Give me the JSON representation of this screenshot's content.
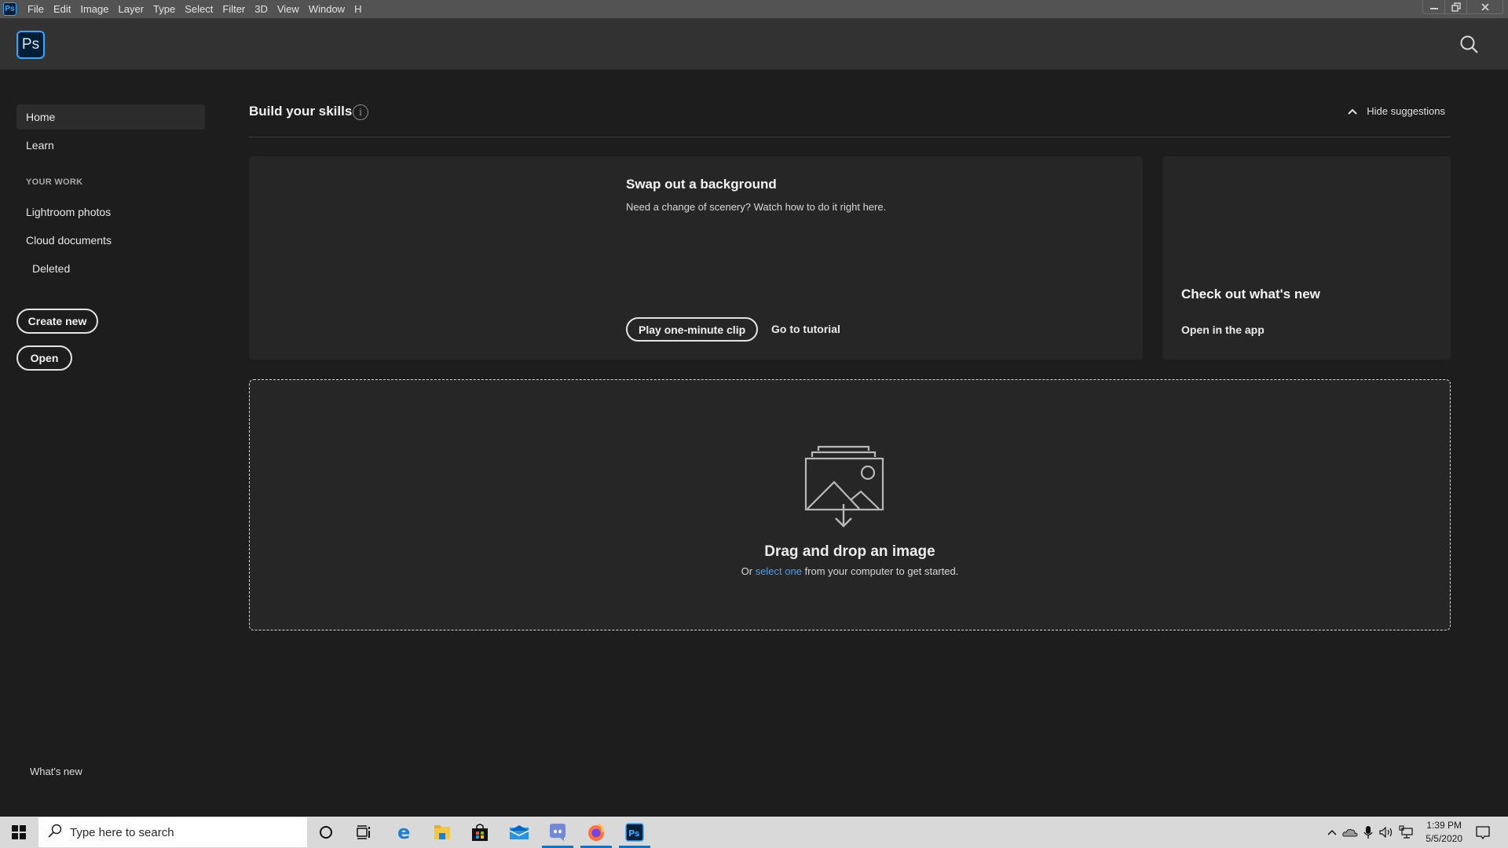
{
  "menubar": {
    "app_icon": "Ps",
    "items": [
      "File",
      "Edit",
      "Image",
      "Layer",
      "Type",
      "Select",
      "Filter",
      "3D",
      "View",
      "Window",
      "H"
    ],
    "window_controls": [
      "minimize-icon",
      "restore-icon",
      "close-icon"
    ]
  },
  "appbar": {
    "logo": "Ps",
    "search_icon": "search-icon"
  },
  "sidebar": {
    "items": [
      {
        "label": "Home",
        "active": true
      },
      {
        "label": "Learn",
        "active": false
      }
    ],
    "section_label": "YOUR WORK",
    "work_items": [
      "Lightroom photos",
      "Cloud documents",
      "Deleted"
    ],
    "create_new_label": "Create new",
    "open_label": "Open",
    "whats_new_label": "What's new"
  },
  "main": {
    "section_title": "Build your skills",
    "info_icon": "info-icon",
    "hide_suggestions_label": "Hide suggestions",
    "card1": {
      "title": "Swap out a background",
      "description": "Need a change of scenery? Watch how to do it right here.",
      "play_label": "Play one-minute clip",
      "tutorial_label": "Go to tutorial"
    },
    "card2": {
      "title": "Check out what's new",
      "link_label": "Open in the app"
    },
    "dropzone": {
      "title": "Drag and drop an image",
      "sub_prefix": "Or ",
      "sub_link": "select one",
      "sub_suffix": " from your computer to get started."
    }
  },
  "taskbar": {
    "search_placeholder": "Type here to search",
    "pinned": [
      "cortana-icon",
      "task-view-icon",
      "edge-icon",
      "file-explorer-icon",
      "store-icon",
      "mail-icon",
      "discord-icon",
      "firefox-icon",
      "photoshop-icon"
    ],
    "time": "1:39 PM",
    "date": "5/5/2020",
    "accent": "#0078d7"
  },
  "colors": {
    "ps_blue": "#31a8ff",
    "link_blue": "#4b9cf5",
    "background": "#1d1d1d",
    "card": "#262626"
  }
}
